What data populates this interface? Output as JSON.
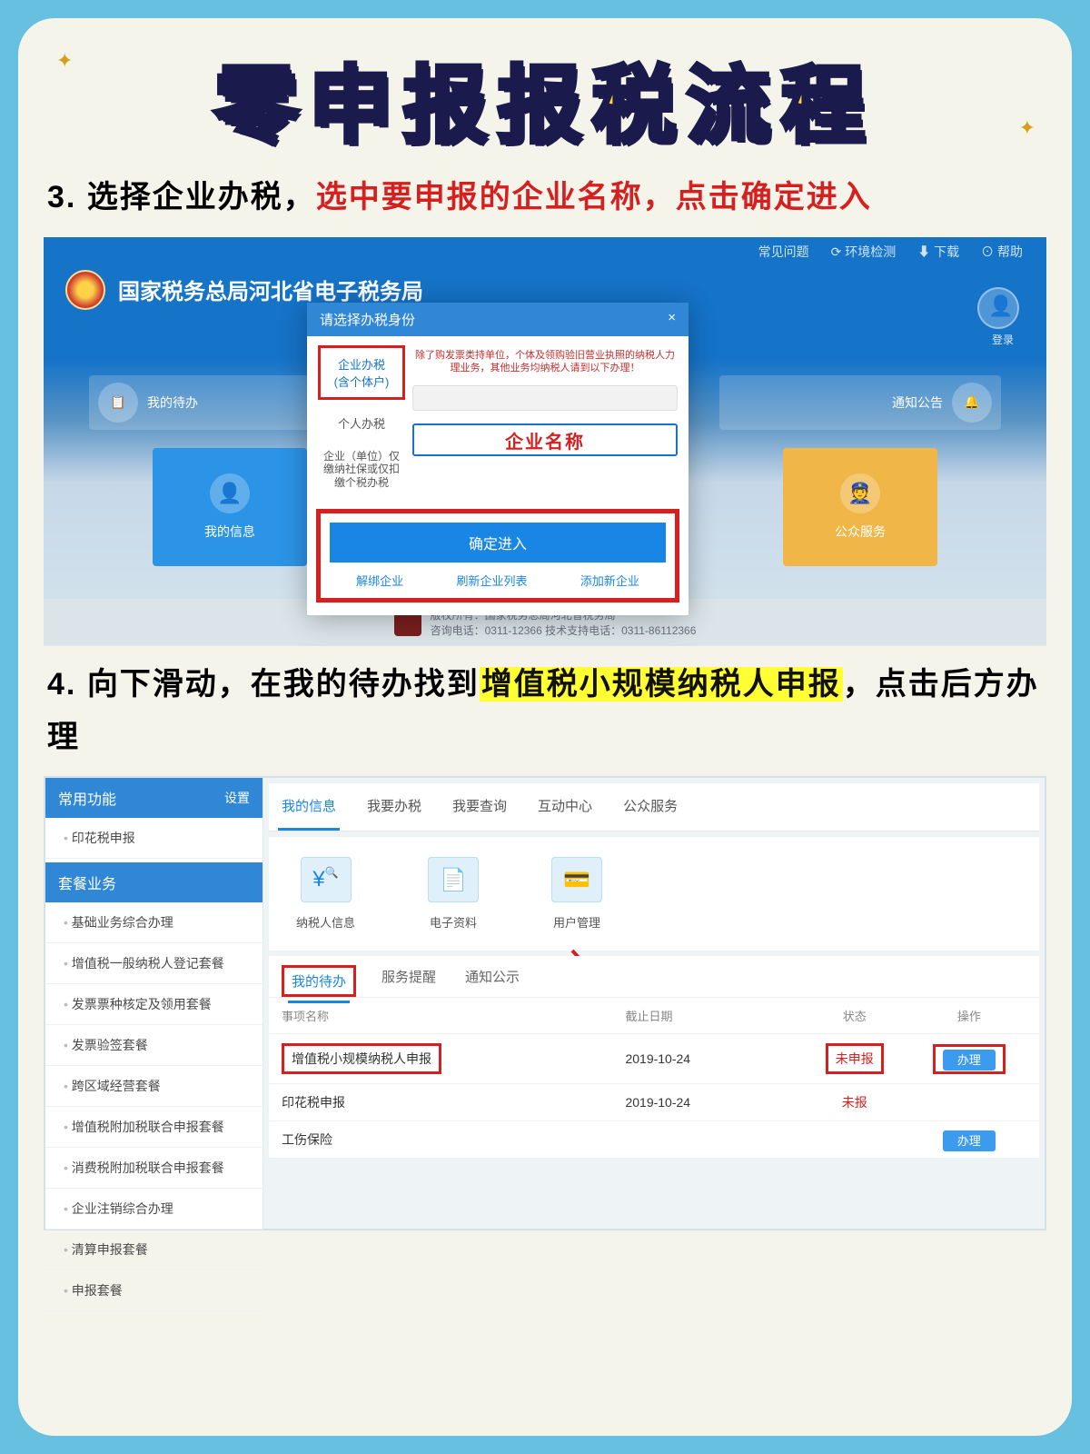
{
  "title": "零申报报税流程",
  "step3": {
    "num": "3.",
    "p1": "选择企业办税，",
    "p2": "选中要申报的企业名称，点击确定进入"
  },
  "step4": {
    "num": "4.",
    "p1": "向下滑动，在我的待办找到",
    "hl": "增值税小规模纳税人申报",
    "p2": "，点击后方办理"
  },
  "shotA": {
    "topbar": [
      "常见问题",
      "⟳ 环境检测",
      "⬇ 下载",
      "⊙ 帮助"
    ],
    "brand": "国家税务总局河北省电子税务局",
    "avatar_lbl": "登录",
    "seg_left": "我的待办",
    "seg_right": "通知公告",
    "tile1": "我的信息",
    "tile2": "公众服务",
    "modal": {
      "title": "请选择办税身份",
      "close": "×",
      "tab1_l1": "企业办税",
      "tab1_l2": "(含个体户)",
      "tab2": "个人办税",
      "tab3": "企业（单位）仅缴纳社保或仅扣缴个税办税",
      "note": "除了购发票类持单位，个体及领购验旧营业执照的纳税人力理业务，其他业务均纳税人请到以下办理！",
      "name_field": "企业名称",
      "confirm": "确定进入",
      "link1": "解绑企业",
      "link2": "刷新企业列表",
      "link3": "添加新企业"
    },
    "footer": {
      "l1": "版权所有：国家税务总局河北省税务局",
      "l2": "咨询电话：0311-12366  技术支持电话：0311-86112366"
    }
  },
  "shotB": {
    "side_h1": "常用功能",
    "side_set": "设置",
    "side_a": "印花税申报",
    "side_h2": "套餐业务",
    "side_items": [
      "基础业务综合办理",
      "增值税一般纳税人登记套餐",
      "发票票种核定及领用套餐",
      "发票验签套餐",
      "跨区域经营套餐",
      "增值税附加税联合申报套餐",
      "消费税附加税联合申报套餐",
      "企业注销综合办理",
      "清算申报套餐",
      "申报套餐"
    ],
    "tabs": [
      "我的信息",
      "我要办税",
      "我要查询",
      "互动中心",
      "公众服务"
    ],
    "icons": [
      "纳税人信息",
      "电子资料",
      "用户管理"
    ],
    "ptabs": [
      "我的待办",
      "服务提醒",
      "通知公示"
    ],
    "thead": [
      "事项名称",
      "截止日期",
      "状态",
      "操作"
    ],
    "rows": [
      {
        "name": "增值税小规模纳税人申报",
        "date": "2019-10-24",
        "status": "未申报",
        "op": "办理"
      },
      {
        "name": "印花税申报",
        "date": "2019-10-24",
        "status": "未报",
        "op": ""
      },
      {
        "name": "工伤保险",
        "date": "",
        "status": "",
        "op": "办理"
      }
    ]
  }
}
